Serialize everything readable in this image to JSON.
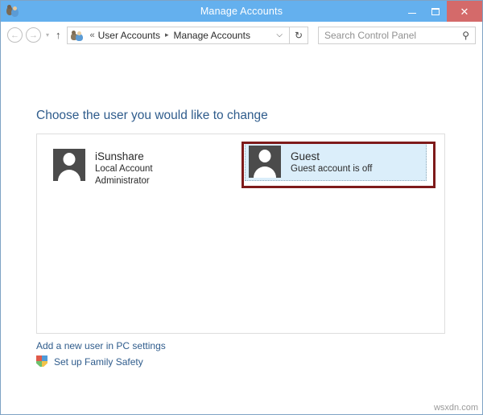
{
  "window": {
    "title": "Manage Accounts",
    "title_icon": "user-accounts-icon",
    "minimize_label": "–",
    "maximize_label": "❑",
    "close_label": "✕"
  },
  "navbar": {
    "back_label": "←",
    "forward_label": "→",
    "recent_label": "▾",
    "up_label": "↑",
    "breadcrumb": {
      "icon": "user-accounts-icon",
      "leading_separator": "«",
      "parent": "User Accounts",
      "separator": "▸",
      "current": "Manage Accounts",
      "dropdown": "⌵"
    },
    "refresh_label": "↻",
    "search": {
      "placeholder": "Search Control Panel",
      "icon": "search-icon"
    }
  },
  "main": {
    "page_title": "Choose the user you would like to change",
    "accounts": [
      {
        "name": "iSunshare",
        "lines": [
          "Local Account",
          "Administrator"
        ],
        "selected": false
      },
      {
        "name": "Guest",
        "lines": [
          "Guest account is off"
        ],
        "selected": true
      }
    ],
    "links": {
      "add_user": "Add a new user in PC settings",
      "family_safety": "Set up Family Safety"
    }
  },
  "annotation": {
    "highlight_color": "#7e1a1a"
  },
  "watermark": "wsxdn.com"
}
